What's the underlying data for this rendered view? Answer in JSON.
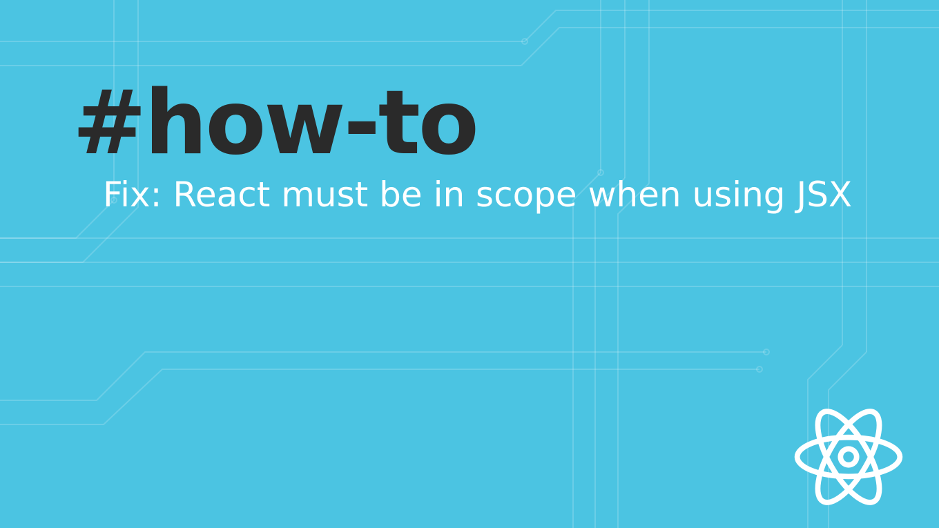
{
  "tag": "#how-to",
  "subtitle": "Fix: React must be in scope when using JSX",
  "logo_name": "react"
}
